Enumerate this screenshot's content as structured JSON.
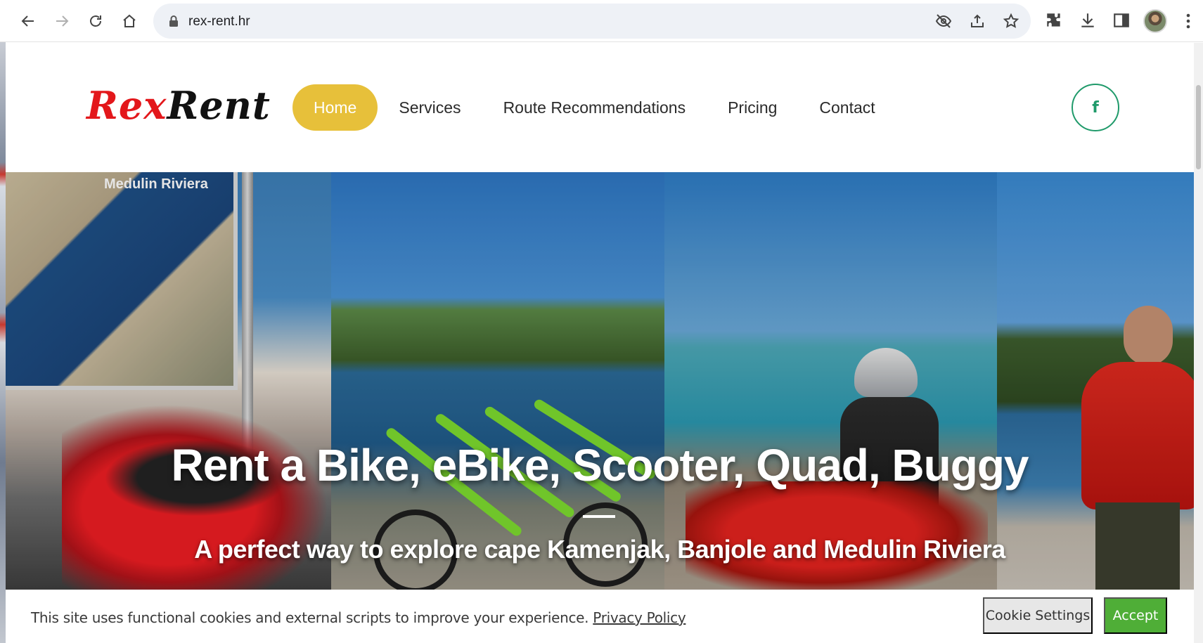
{
  "browser": {
    "url": "rex-rent.hr"
  },
  "header": {
    "logo_text_1": "Rex",
    "logo_text_2": "Rent",
    "nav": [
      {
        "label": "Home"
      },
      {
        "label": "Services"
      },
      {
        "label": "Route Recommendations"
      },
      {
        "label": "Pricing"
      },
      {
        "label": "Contact"
      }
    ],
    "facebook_label": "f"
  },
  "hero": {
    "map_title": "Medulin Riviera",
    "title": "Rent a Bike, eBike, Scooter, Quad, Buggy",
    "subtitle": "A perfect way to explore cape Kamenjak, Banjole and Medulin Riviera"
  },
  "cookie_bar": {
    "text": "This site uses functional cookies and external scripts to improve your experience.",
    "link": "Privacy Policy",
    "settings_label": "Cookie Settings",
    "accept_label": "Accept"
  },
  "colors": {
    "brand_red": "#e3171b",
    "nav_active": "#e7c03a",
    "facebook_green": "#1f9a6a",
    "accept_green": "#4fae37"
  },
  "icons": [
    "back-icon",
    "forward-icon",
    "reload-icon",
    "home-icon",
    "lock-icon",
    "eye-off-icon",
    "share-icon",
    "star-icon",
    "extensions-icon",
    "download-icon",
    "side-panel-icon",
    "menu-icon",
    "facebook-icon"
  ]
}
